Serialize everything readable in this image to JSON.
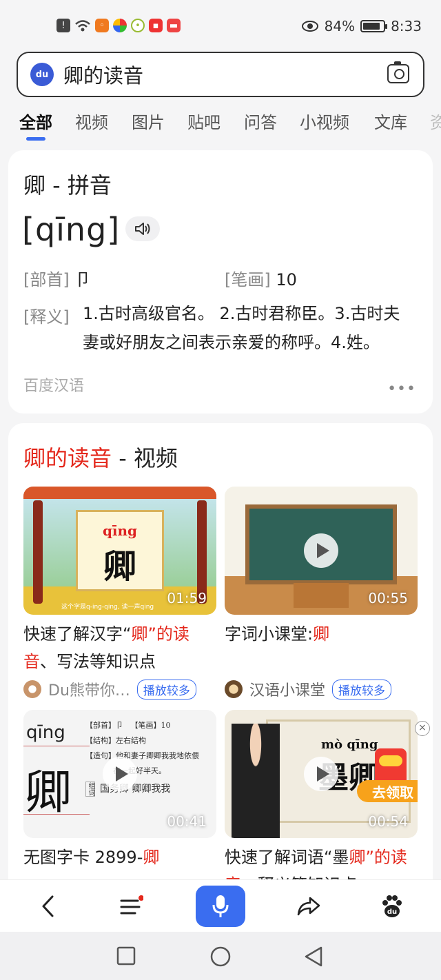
{
  "status_bar": {
    "battery": "84%",
    "time": "8:33"
  },
  "search": {
    "query": "卿的读音"
  },
  "tabs": [
    "全部",
    "视频",
    "图片",
    "贴吧",
    "问答",
    "小视频",
    "文库",
    "资"
  ],
  "dictionary": {
    "title": "卿 - 拼音",
    "pinyin": "[qīng]",
    "radical_label": "[部首]",
    "radical_value": "卩",
    "strokes_label": "[笔画]",
    "strokes_value": "10",
    "meaning_label": "[释义]",
    "meaning": "1.古时高级官名。 2.古时君称臣。3.古时夫妻或好朋友之间表示亲爱的称呼。4.姓。",
    "source": "百度汉语"
  },
  "video_section": {
    "title_highlight": "卿的读音",
    "title_rest": " - 视频",
    "videos": [
      {
        "duration": "01:59",
        "title_pre": "快速了解汉字“",
        "title_hl": "卿",
        "title_mid": "”的",
        "title_hl2": "读音",
        "title_post": "、写法等知识点",
        "author": "Du熊带你…",
        "badge": "播放较多",
        "thumb_pinyin": "qīng",
        "thumb_char": "卿",
        "thumb_caption": "这个字是q-ing-qing, 读一声qing"
      },
      {
        "duration": "00:55",
        "title_pre": "字词小课堂:",
        "title_hl": "卿",
        "author": "汉语小课堂",
        "badge": "播放较多"
      },
      {
        "duration": "00:41",
        "title_pre": "无图字卡 2899-",
        "title_hl": "卿",
        "thumb_pinyin": "qīng",
        "thumb_char": "卿",
        "thumb_lines": [
          "【部首】卩",
          "【笔画】10",
          "【结构】左右结构",
          "【造句】他和妻子卿卿我我地依偎",
          "在一起好半天。",
          "国务卿  卿卿我我"
        ],
        "thumb_group": "组词"
      },
      {
        "duration": "00:54",
        "title_pre": "快速了解词语“墨",
        "title_hl": "卿",
        "title_mid": "”的",
        "title_hl2": "读音",
        "title_post": "、释义等知识点",
        "thumb_pinyin": "mò qīng",
        "thumb_word": "墨卿",
        "promo": "去领取"
      }
    ]
  },
  "colors": {
    "accent": "#3a6df0",
    "highlight": "#e4281c"
  }
}
